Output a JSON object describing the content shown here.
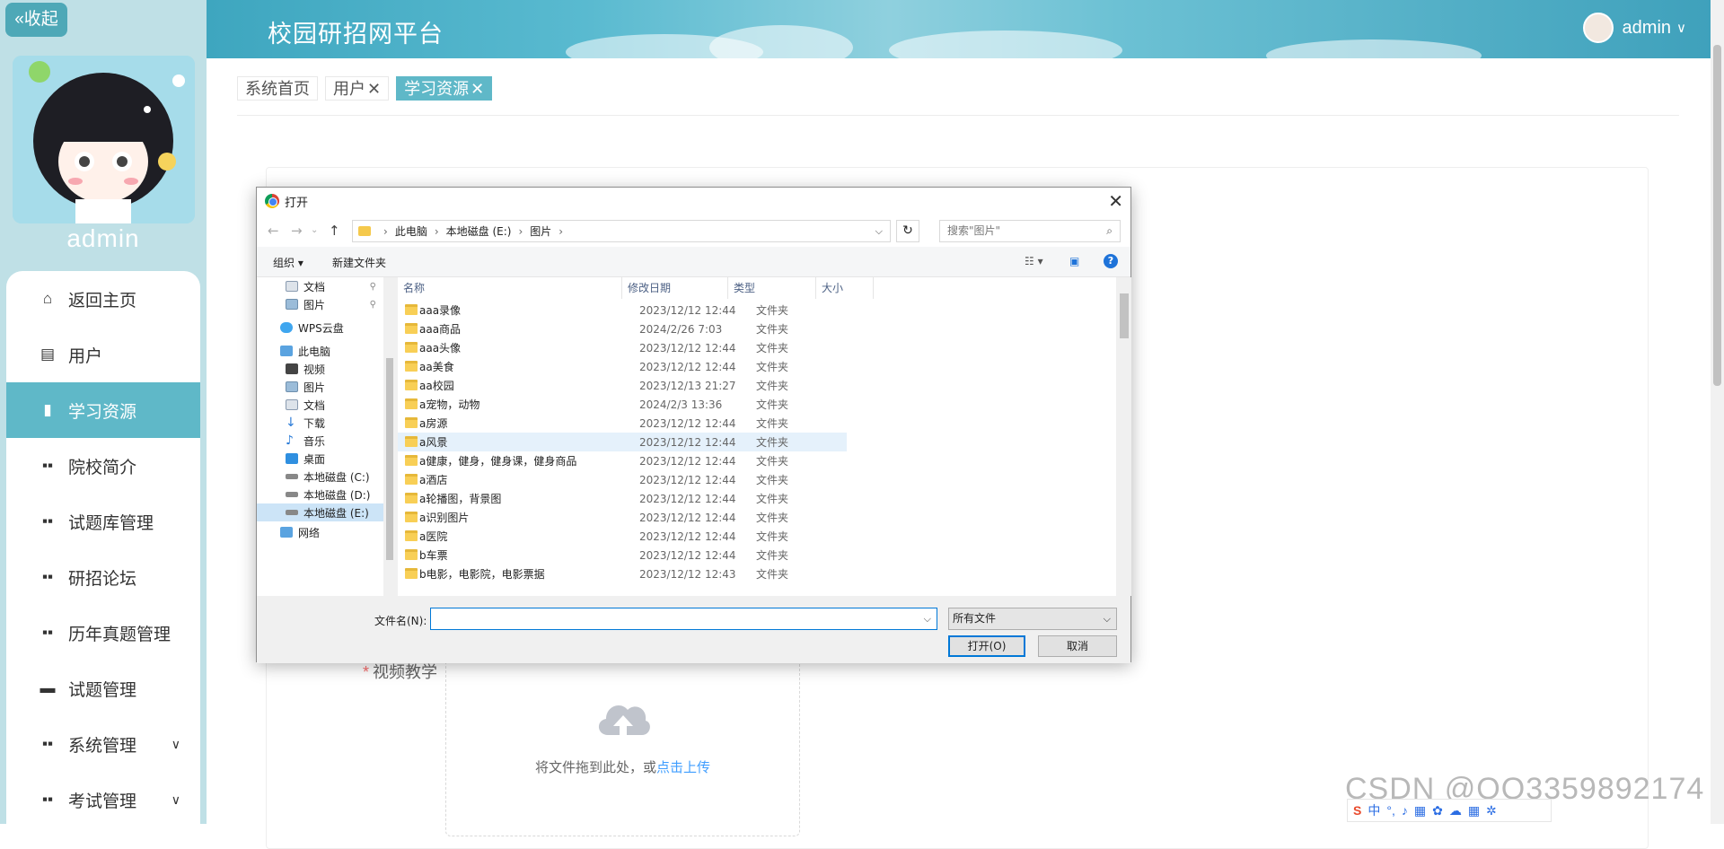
{
  "sidebar": {
    "collapse_label": "«收起",
    "username": "admin",
    "menu": [
      {
        "label": "返回主页",
        "icon": "home-icon"
      },
      {
        "label": "用户",
        "icon": "user-icon"
      },
      {
        "label": "学习资源",
        "icon": "book-icon",
        "active": true
      },
      {
        "label": "院校简介",
        "icon": "grid-icon"
      },
      {
        "label": "试题库管理",
        "icon": "grid-icon"
      },
      {
        "label": "研招论坛",
        "icon": "grid-icon"
      },
      {
        "label": "历年真题管理",
        "icon": "grid-icon"
      },
      {
        "label": "试题管理",
        "icon": "briefcase-icon"
      },
      {
        "label": "系统管理",
        "icon": "grid-icon",
        "expandable": true
      },
      {
        "label": "考试管理",
        "icon": "grid-icon",
        "expandable": true
      }
    ]
  },
  "header": {
    "title": "校园研招网平台",
    "user": "admin",
    "dropdown_icon": "chevron-down-icon"
  },
  "tags": [
    {
      "label": "系统首页"
    },
    {
      "label": "用户",
      "closable": true
    },
    {
      "label": "学习资源",
      "closable": true,
      "active": true
    }
  ],
  "form": {
    "field_label": "视频教学",
    "upload_text": "将文件拖到此处，或",
    "upload_link": "点击上传"
  },
  "watermark": "CSDN @QQ3359892174",
  "ime_bar": "中",
  "dialog": {
    "title": "打开",
    "close": "✕",
    "path": [
      "此电脑",
      "本地磁盘 (E:)",
      "图片"
    ],
    "search_placeholder": "搜索\"图片\"",
    "toolbar": {
      "organize": "组织 ▾",
      "new_folder": "新建文件夹"
    },
    "nav_items": [
      {
        "label": "文档",
        "pinned": true
      },
      {
        "label": "图片",
        "pinned": true
      },
      {
        "label": "WPS云盘"
      },
      {
        "label": "此电脑"
      },
      {
        "label": "视频"
      },
      {
        "label": "图片"
      },
      {
        "label": "文档"
      },
      {
        "label": "下载"
      },
      {
        "label": "音乐"
      },
      {
        "label": "桌面"
      },
      {
        "label": "本地磁盘 (C:)"
      },
      {
        "label": "本地磁盘 (D:)"
      },
      {
        "label": "本地磁盘 (E:)",
        "selected": true
      },
      {
        "label": "网络"
      }
    ],
    "columns": {
      "name": "名称",
      "date": "修改日期",
      "type": "类型",
      "size": "大小"
    },
    "files": [
      {
        "name": "aaa录像",
        "date": "2023/12/12 12:44",
        "type": "文件夹"
      },
      {
        "name": "aaa商品",
        "date": "2024/2/26 7:03",
        "type": "文件夹"
      },
      {
        "name": "aaa头像",
        "date": "2023/12/12 12:44",
        "type": "文件夹"
      },
      {
        "name": "aa美食",
        "date": "2023/12/12 12:44",
        "type": "文件夹"
      },
      {
        "name": "aa校园",
        "date": "2023/12/13 21:27",
        "type": "文件夹"
      },
      {
        "name": "a宠物，动物",
        "date": "2024/2/3 13:36",
        "type": "文件夹"
      },
      {
        "name": "a房源",
        "date": "2023/12/12 12:44",
        "type": "文件夹"
      },
      {
        "name": "a风景",
        "date": "2023/12/12 12:44",
        "type": "文件夹",
        "hover": true
      },
      {
        "name": "a健康，健身，健身课，健身商品",
        "date": "2023/12/12 12:44",
        "type": "文件夹"
      },
      {
        "name": "a酒店",
        "date": "2023/12/12 12:44",
        "type": "文件夹"
      },
      {
        "name": "a轮播图，背景图",
        "date": "2023/12/12 12:44",
        "type": "文件夹"
      },
      {
        "name": "a识别图片",
        "date": "2023/12/12 12:44",
        "type": "文件夹"
      },
      {
        "name": "a医院",
        "date": "2023/12/12 12:44",
        "type": "文件夹"
      },
      {
        "name": "b车票",
        "date": "2023/12/12 12:44",
        "type": "文件夹"
      },
      {
        "name": "b电影，电影院，电影票据",
        "date": "2023/12/12 12:43",
        "type": "文件夹"
      }
    ],
    "filename_label": "文件名(N):",
    "filename_value": "",
    "filetype": "所有文件",
    "open_label": "打开(O)",
    "cancel_label": "取消"
  }
}
